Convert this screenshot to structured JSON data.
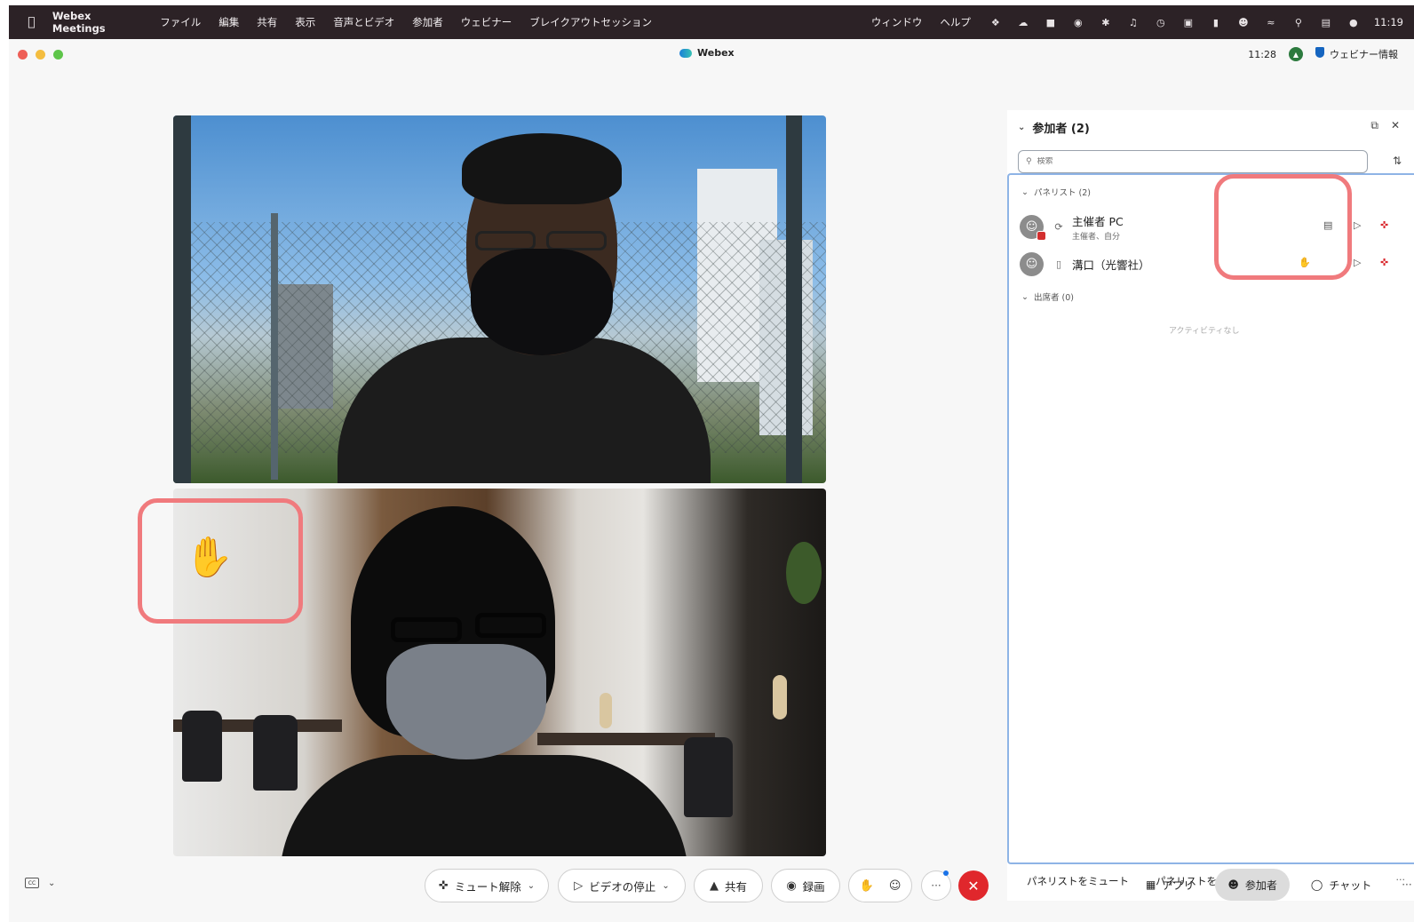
{
  "menubar": {
    "app_name": "Webex Meetings",
    "menus": [
      "ファイル",
      "編集",
      "共有",
      "表示",
      "音声とビデオ",
      "参加者",
      "ウェビナー",
      "ブレイクアウトセッション"
    ],
    "menus_right": [
      "ウィンドウ",
      "ヘルプ"
    ],
    "clock": "11:19"
  },
  "window": {
    "title": "Webex",
    "time": "11:28",
    "webinar_info": "ウェビナー情報"
  },
  "controls": {
    "unmute": "ミュート解除",
    "stop_video": "ビデオの停止",
    "share": "共有",
    "record": "録画",
    "more": "···",
    "apps": "アプリ",
    "participants": "参加者",
    "chat": "チャット",
    "right_more": "···"
  },
  "panel": {
    "title": "参加者 (2)",
    "search_placeholder": "検索",
    "panelists_label": "パネリスト (2)",
    "attendees_label": "出席者 (0)",
    "no_activity": "アクティビティなし",
    "participants": [
      {
        "name": "主催者 PC",
        "sub": "主催者、自分"
      },
      {
        "name": "溝口（光響社）",
        "sub": ""
      }
    ],
    "mute_panelists": "パネリストをミュート",
    "unmute_panelists": "パネリストをミュート解除",
    "footer_more": "···"
  },
  "colors": {
    "highlight": "#f07a7d",
    "end_call": "#e0272c",
    "mic_muted": "#d9262c"
  }
}
